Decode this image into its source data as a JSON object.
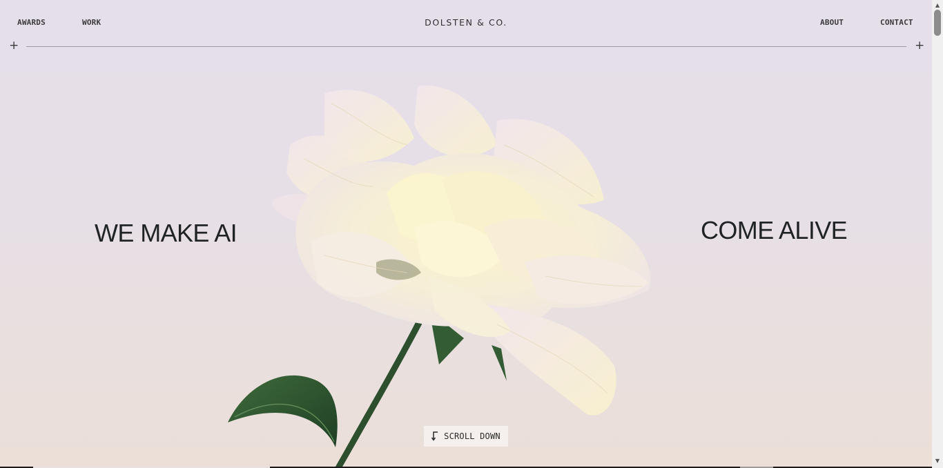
{
  "nav": {
    "awards": "AWARDS",
    "work": "WORK",
    "brand": "DOLSTEN & CO.",
    "about": "ABOUT",
    "contact": "CONTACT"
  },
  "hero": {
    "left_text": "WE MAKE AI",
    "right_text": "COME ALIVE",
    "scroll_label": "SCROLL DOWN",
    "scroll_icon": "arrow-down-left-icon"
  },
  "decor": {
    "plus_glyph": "+",
    "flower": "peony-flower-image"
  },
  "colors": {
    "text": "#1f2324",
    "background_top": "#e5dfea",
    "background_bottom": "#ebdfd7",
    "petal": "#f6efcf",
    "leaf": "#2f5a32"
  }
}
